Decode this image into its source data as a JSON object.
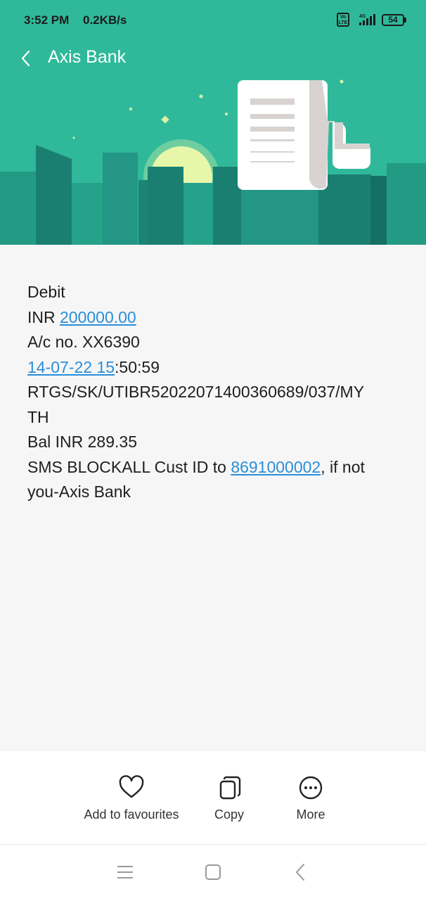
{
  "status_bar": {
    "time": "3:52 PM",
    "network_speed": "0.2KB/s",
    "volte_label": "Vo LTE",
    "network_type": "4G",
    "battery": "54",
    "icons": [
      "volte-icon",
      "signal-icon",
      "battery-icon"
    ]
  },
  "header": {
    "title": "Axis Bank",
    "back_icon": "chevron-left-icon",
    "colors": {
      "background": "#2fb99a",
      "title": "#ffffff"
    }
  },
  "message": {
    "type": "Debit",
    "amount_prefix": "INR ",
    "amount": "200000.00",
    "account": "A/c no. XX6390",
    "date_link": "14-07-22 15",
    "time_rest": ":50:59",
    "reference_line1": "RTGS/SK/UTIBR52022071400360689/037/MY",
    "reference_line2": "TH",
    "balance": "Bal INR 289.35",
    "sms_prefix": "SMS BLOCKALL Cust ID to ",
    "sms_number": "8691000002",
    "sms_suffix": ", if not",
    "sms_line2": "you-Axis Bank",
    "link_color": "#2a8ed8"
  },
  "actions": [
    {
      "label": "Add to favourites",
      "icon": "heart-icon"
    },
    {
      "label": "Copy",
      "icon": "copy-icon"
    },
    {
      "label": "More",
      "icon": "more-icon"
    }
  ],
  "navigation": {
    "buttons": [
      "menu-icon",
      "home-icon",
      "back-icon"
    ]
  }
}
